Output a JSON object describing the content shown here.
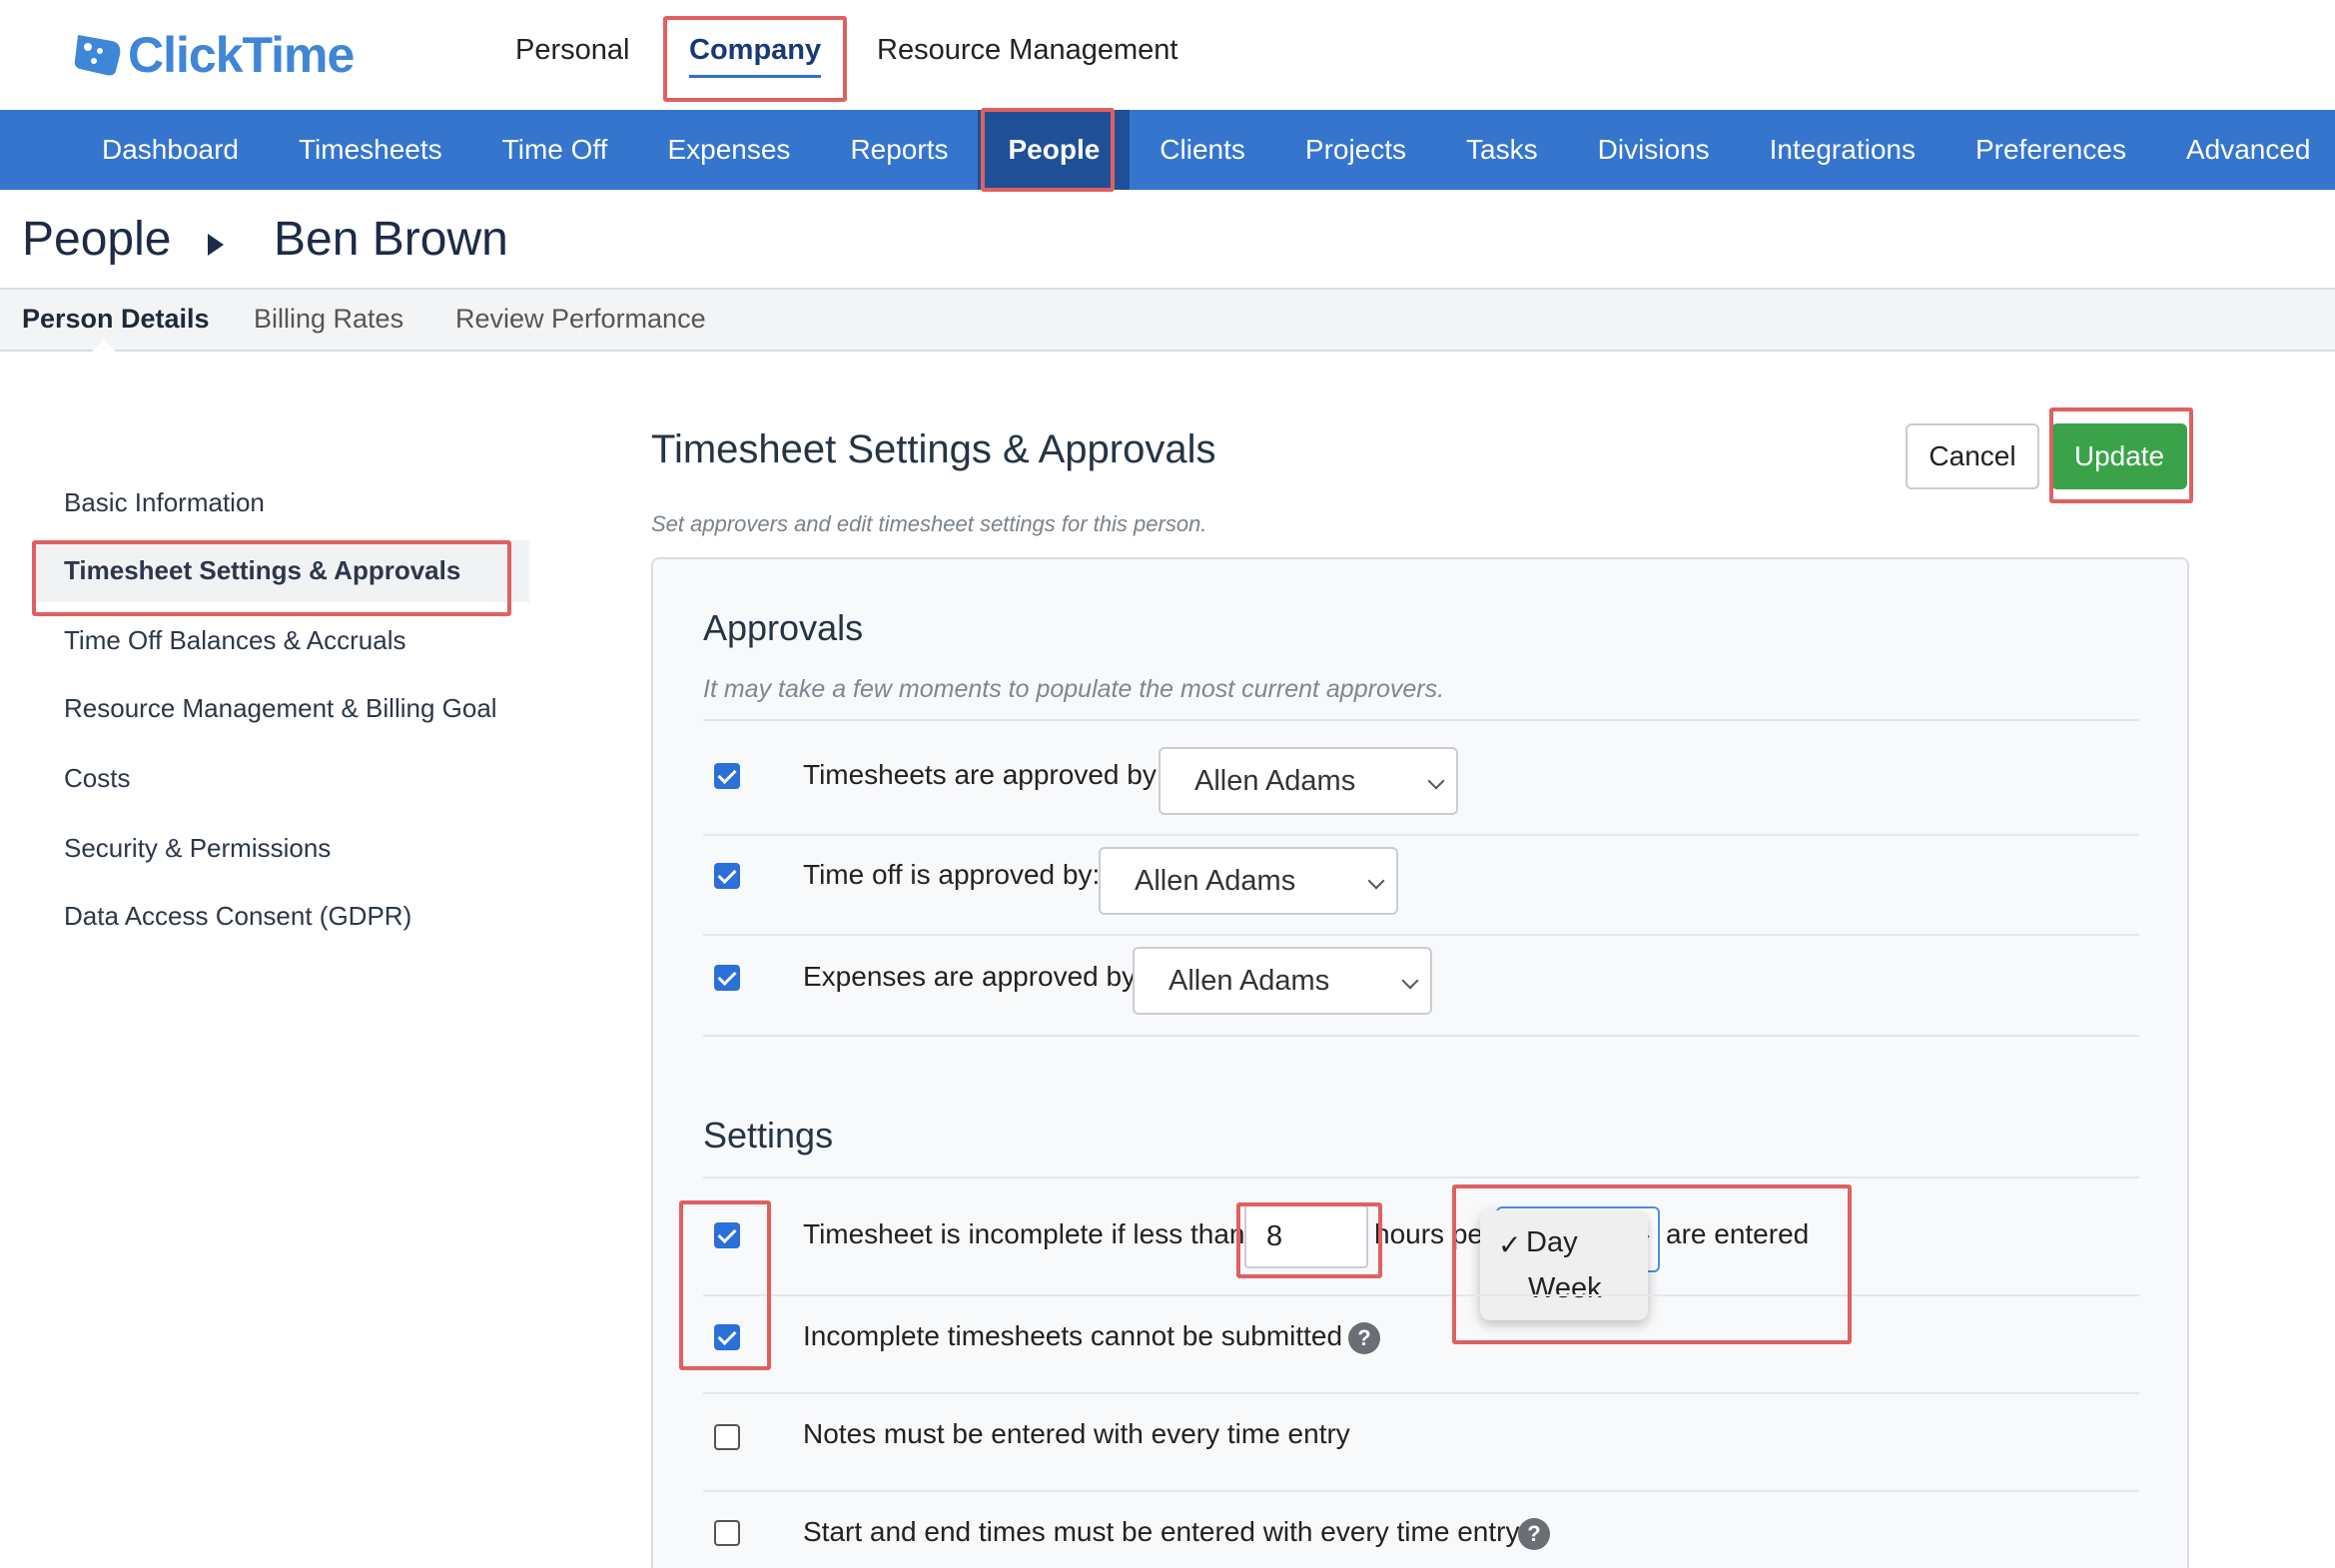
{
  "app": {
    "logo_text": "ClickTime"
  },
  "top_tabs": [
    "Personal",
    "Company",
    "Resource Management"
  ],
  "main_nav": [
    "Dashboard",
    "Timesheets",
    "Time Off",
    "Expenses",
    "Reports",
    "People",
    "Clients",
    "Projects",
    "Tasks",
    "Divisions",
    "Integrations",
    "Preferences",
    "Advanced"
  ],
  "breadcrumb": {
    "root": "People",
    "current": "Ben Brown"
  },
  "sub_tabs": [
    "Person Details",
    "Billing Rates",
    "Review Performance"
  ],
  "sidebar": [
    "Basic Information",
    "Timesheet Settings & Approvals",
    "Time Off Balances & Accruals",
    "Resource Management & Billing Goal",
    "Costs",
    "Security & Permissions",
    "Data Access Consent (GDPR)"
  ],
  "content": {
    "title": "Timesheet Settings & Approvals",
    "subtitle": "Set approvers and edit timesheet settings for this person.",
    "cancel_label": "Cancel",
    "update_label": "Update"
  },
  "approvals": {
    "heading": "Approvals",
    "note": "It may take a few moments to populate the most current approvers.",
    "rows": [
      {
        "label": "Timesheets are approved by:",
        "value": "Allen Adams",
        "checked": true
      },
      {
        "label": "Time off is approved by:",
        "value": "Allen Adams",
        "checked": true
      },
      {
        "label": "Expenses are approved by:",
        "value": "Allen Adams",
        "checked": true
      }
    ]
  },
  "settings": {
    "heading": "Settings",
    "incomplete_prefix": "Timesheet is incomplete if less than",
    "hours_value": "8",
    "hours_text": "hours pe",
    "incomplete_suffix": "are entered",
    "period_options": [
      "Day",
      "Week"
    ],
    "period_selected": "Day",
    "cannot_submit_label": "Incomplete timesheets cannot be submitted",
    "notes_label": "Notes must be entered with every time entry",
    "start_end_label": "Start and end times must be entered with every time entry",
    "help_glyph": "?",
    "check_glyph": "✓"
  },
  "colors": {
    "nav_bg": "#3575cd",
    "nav_active": "#1f4f97",
    "update_button": "#3aa34a",
    "checkbox": "#2b6fd8",
    "callout": "#e06060"
  }
}
